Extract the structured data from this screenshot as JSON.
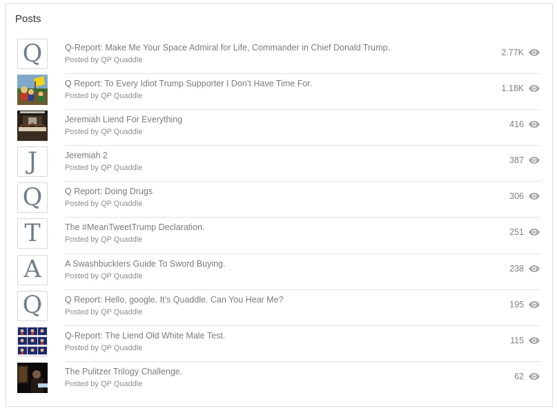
{
  "header": {
    "title": "Posts"
  },
  "posts": [
    {
      "thumb": "Q",
      "thumb_kind": "letter",
      "title": "Q-Report: Make Me Your Space Admiral for Life, Commander in Chief Donald Trump.",
      "meta": "Posted by QP Quaddle",
      "views": "2.77K",
      "icon": "eye-icon"
    },
    {
      "thumb": "",
      "thumb_kind": "image-cartoon",
      "title": "Q Report: To Every Idiot Trump Supporter I Don’t Have Time For.",
      "meta": "Posted by QP Quaddle",
      "views": "1.18K",
      "icon": "eye-icon"
    },
    {
      "thumb": "",
      "thumb_kind": "image-painting",
      "title": "Jeremiah Liend For Everything",
      "meta": "Posted by QP Quaddle",
      "views": "416",
      "icon": "eye-icon"
    },
    {
      "thumb": "J",
      "thumb_kind": "letter",
      "title": "Jeremiah 2",
      "meta": "Posted by QP Quaddle",
      "views": "387",
      "icon": "eye-icon"
    },
    {
      "thumb": "Q",
      "thumb_kind": "letter",
      "title": "Q Report: Doing Drugs",
      "meta": "Posted by QP Quaddle",
      "views": "306",
      "icon": "eye-icon"
    },
    {
      "thumb": "T",
      "thumb_kind": "letter",
      "title": "The #MeanTweetTrump Declaration.",
      "meta": "Posted by QP Quaddle",
      "views": "251",
      "icon": "eye-icon"
    },
    {
      "thumb": "A",
      "thumb_kind": "letter",
      "title": "A Swashbucklers Guide To Sword Buying.",
      "meta": "Posted by QP Quaddle",
      "views": "238",
      "icon": "eye-icon"
    },
    {
      "thumb": "Q",
      "thumb_kind": "letter",
      "title": "Q Report: Hello, google. It’s Quaddle. Can You Hear Me?",
      "meta": "Posted by QP Quaddle",
      "views": "195",
      "icon": "eye-icon"
    },
    {
      "thumb": "",
      "thumb_kind": "image-grid",
      "title": "Q-Report: The Liend Old White Male Test.",
      "meta": "Posted by QP Quaddle",
      "views": "115",
      "icon": "eye-icon"
    },
    {
      "thumb": "",
      "thumb_kind": "image-dark",
      "title": "The Pulitzer Trilogy Challenge.",
      "meta": "Posted by QP Quaddle",
      "views": "62",
      "icon": "eye-icon"
    }
  ],
  "colors": {
    "border": "#dcdcdc",
    "text": "#7a7a7a",
    "letter": "#6e7f8b",
    "icon": "#9e9e9e"
  }
}
